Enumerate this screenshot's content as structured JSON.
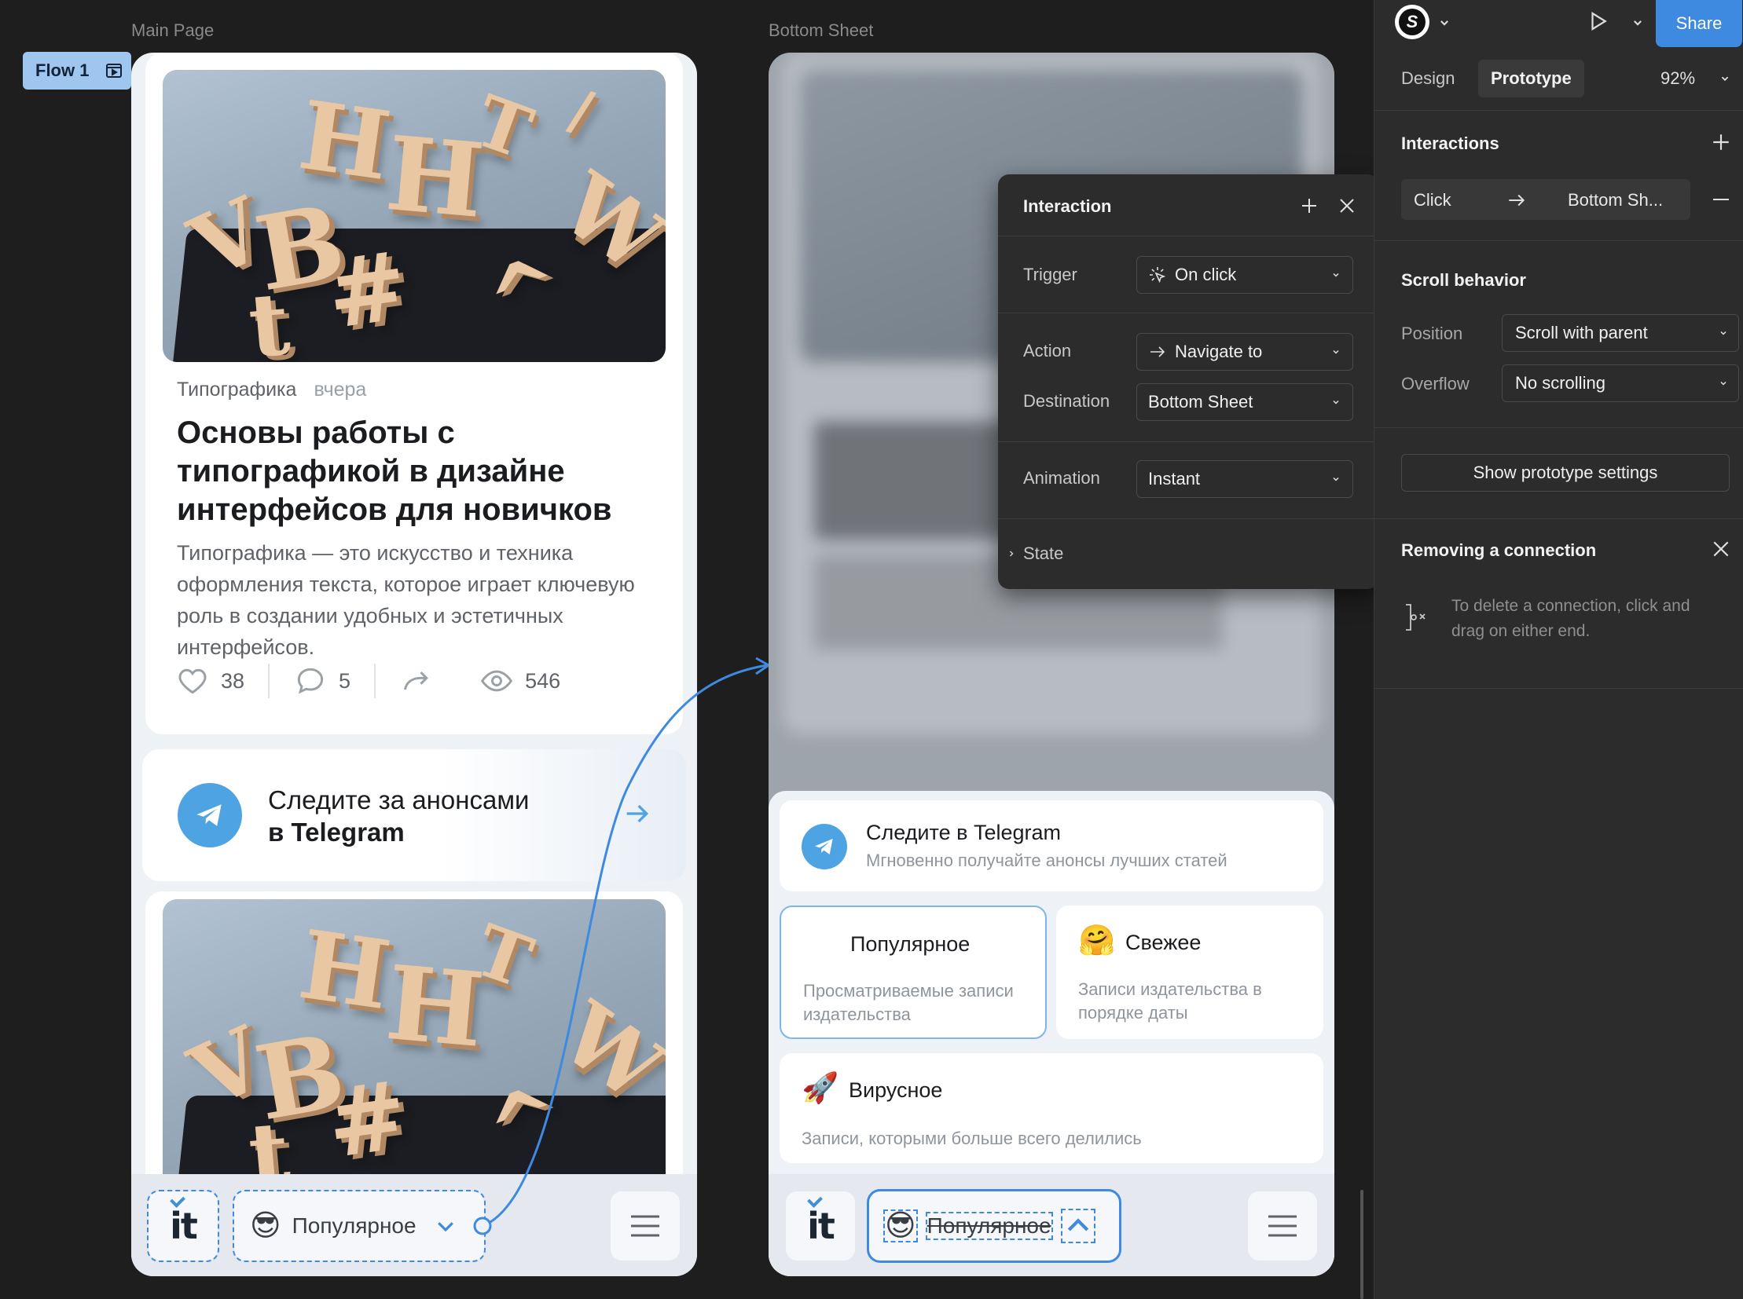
{
  "canvas": {
    "frame1_label": "Main Page",
    "frame2_label": "Bottom Sheet",
    "flow_label": "Flow 1"
  },
  "article": {
    "category": "Типографика",
    "date": "вчера",
    "title": "Основы работы с типографикой в дизайне интерфейсов для новичков",
    "excerpt": "Типографика — это искусство и техника оформления текста, которое играет ключевую роль в создании удобных и эстетичных интерфейсов.",
    "likes": "38",
    "comments": "5",
    "views": "546"
  },
  "promo": {
    "line1": "Следите за анонсами",
    "line2": "в Telegram"
  },
  "bottombar": {
    "logo": "it",
    "feed": "Популярное",
    "feed_emoji": "😎"
  },
  "sheet": {
    "telegram_title": "Следите в Telegram",
    "telegram_sub": "Мгновенно получайте анонсы лучших статей",
    "popular_title": "Популярное",
    "popular_emoji": "😎",
    "popular_sub": "Просматриваемые записи издательства",
    "fresh_title": "Свежее",
    "fresh_emoji": "🤗",
    "fresh_sub": "Записи издательства в порядке даты",
    "viral_title": "Вирусное",
    "viral_emoji": "🚀",
    "viral_sub": "Записи, которыми больше всего делились"
  },
  "interaction": {
    "title": "Interaction",
    "trigger_label": "Trigger",
    "trigger_value": "On click",
    "action_label": "Action",
    "action_value": "Navigate to",
    "destination_label": "Destination",
    "destination_value": "Bottom Sheet",
    "animation_label": "Animation",
    "animation_value": "Instant",
    "state_label": "State"
  },
  "toolbar": {
    "share": "Share",
    "zoom": "92%"
  },
  "panel": {
    "tab_design": "Design",
    "tab_prototype": "Prototype",
    "interactions_heading": "Interactions",
    "interaction_trigger": "Click",
    "interaction_target": "Bottom Sh...",
    "scroll_heading": "Scroll behavior",
    "position_label": "Position",
    "position_value": "Scroll with parent",
    "overflow_label": "Overflow",
    "overflow_value": "No scrolling",
    "show_settings": "Show prototype settings",
    "removing_heading": "Removing a connection",
    "removing_text": "To delete a connection, click and drag on either end."
  },
  "colors": {
    "accent": "#3d8ae0",
    "share_button": "#3d8ae0",
    "telegram": "#4ea3e3",
    "canvas": "#1e1e1e",
    "panel": "#2c2c2c"
  }
}
